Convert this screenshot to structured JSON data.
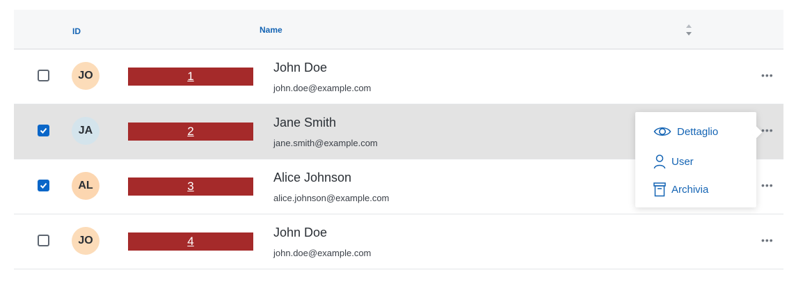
{
  "header": {
    "id_label": "ID",
    "name_label": "Name"
  },
  "rows": [
    {
      "initials": "JO",
      "avatar_color": "#fcdcb9",
      "id": "1",
      "name": "John Doe",
      "email": "john.doe@example.com",
      "checked": false,
      "selected": false
    },
    {
      "initials": "JA",
      "avatar_color": "#d4e4ec",
      "id": "2",
      "name": "Jane Smith",
      "email": "jane.smith@example.com",
      "checked": true,
      "selected": true
    },
    {
      "initials": "AL",
      "avatar_color": "#fcd6b0",
      "id": "3",
      "name": "Alice Johnson",
      "email": "alice.johnson@example.com",
      "checked": true,
      "selected": false
    },
    {
      "initials": "JO",
      "avatar_color": "#fcdcb9",
      "id": "4",
      "name": "John Doe",
      "email": "john.doe@example.com",
      "checked": false,
      "selected": false
    }
  ],
  "context_menu": {
    "items": [
      {
        "label": "Dettaglio",
        "icon": "eye-icon"
      },
      {
        "label": "User",
        "icon": "user-icon"
      },
      {
        "label": "Archivia",
        "icon": "archive-icon"
      }
    ]
  },
  "more_label": "•••",
  "colors": {
    "accent": "#1464b4",
    "id_bar": "#a52a2a",
    "checkbox_checked": "#0a66c8",
    "selected_row": "#e3e3e3"
  }
}
